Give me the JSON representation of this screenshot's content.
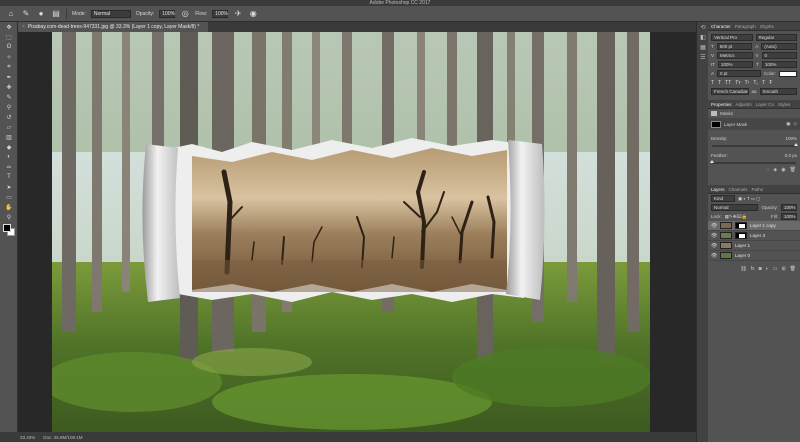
{
  "window": {
    "title": "Adobe Photoshop CC 2017"
  },
  "options_bar": {
    "mode_label": "Mode:",
    "mode_value": "Normal",
    "opacity_label": "Opacity:",
    "opacity_value": "100%",
    "flow_label": "Flow:",
    "flow_value": "100%"
  },
  "document": {
    "tab_title": "Pixabay.com-dead-trees-947331.jpg @ 33.3% (Layer 1 copy, Layer Mask/8) *"
  },
  "status": {
    "zoom": "33.33%",
    "doc_size": "Doc: 25.9M/108.1M"
  },
  "character_panel": {
    "tabs": [
      "Character",
      "Paragraph",
      "Glyphs"
    ],
    "font_family": "Vertical Pro",
    "font_style": "Regular",
    "font_size": "500 pt",
    "leading": "(Auto)",
    "kerning": "Metrics",
    "tracking": "0",
    "vscale": "100%",
    "hscale": "100%",
    "baseline": "0 pt",
    "color_label": "Color:",
    "language": "French Canadian",
    "antialias": "Smooth"
  },
  "properties_panel": {
    "tabs": [
      "Properties",
      "Adjustm",
      "Layer Co",
      "Styles"
    ],
    "mode": "Masks",
    "mask_label": "Layer Mask",
    "density_label": "Density:",
    "density_value": "100%",
    "density_level": 1.0,
    "feather_label": "Feather:",
    "feather_value": "0.0 px",
    "feather_level": 0.0
  },
  "layers_panel": {
    "tabs": [
      "Layers",
      "Channels",
      "Paths"
    ],
    "filter_kind": "Kind",
    "blend_mode": "Normal",
    "opacity_label": "Opacity:",
    "opacity_value": "100%",
    "lock_label": "Lock:",
    "fill_label": "Fill:",
    "fill_value": "100%",
    "layers": [
      {
        "name": "Layer 1 copy",
        "has_mask": true,
        "selected": true,
        "thumb_color": "#7a6a52"
      },
      {
        "name": "Layer 3",
        "has_mask": true,
        "selected": false,
        "thumb_color": "#6f7a4a"
      },
      {
        "name": "Layer 1",
        "has_mask": false,
        "selected": false,
        "thumb_color": "#8a7a5e"
      },
      {
        "name": "Layer 0",
        "has_mask": false,
        "selected": false,
        "thumb_color": "#5e7a3e"
      }
    ]
  },
  "colors": {
    "panel_bg": "#535353",
    "canvas_bg": "#282828",
    "selected_layer": "#6a6a6a"
  }
}
